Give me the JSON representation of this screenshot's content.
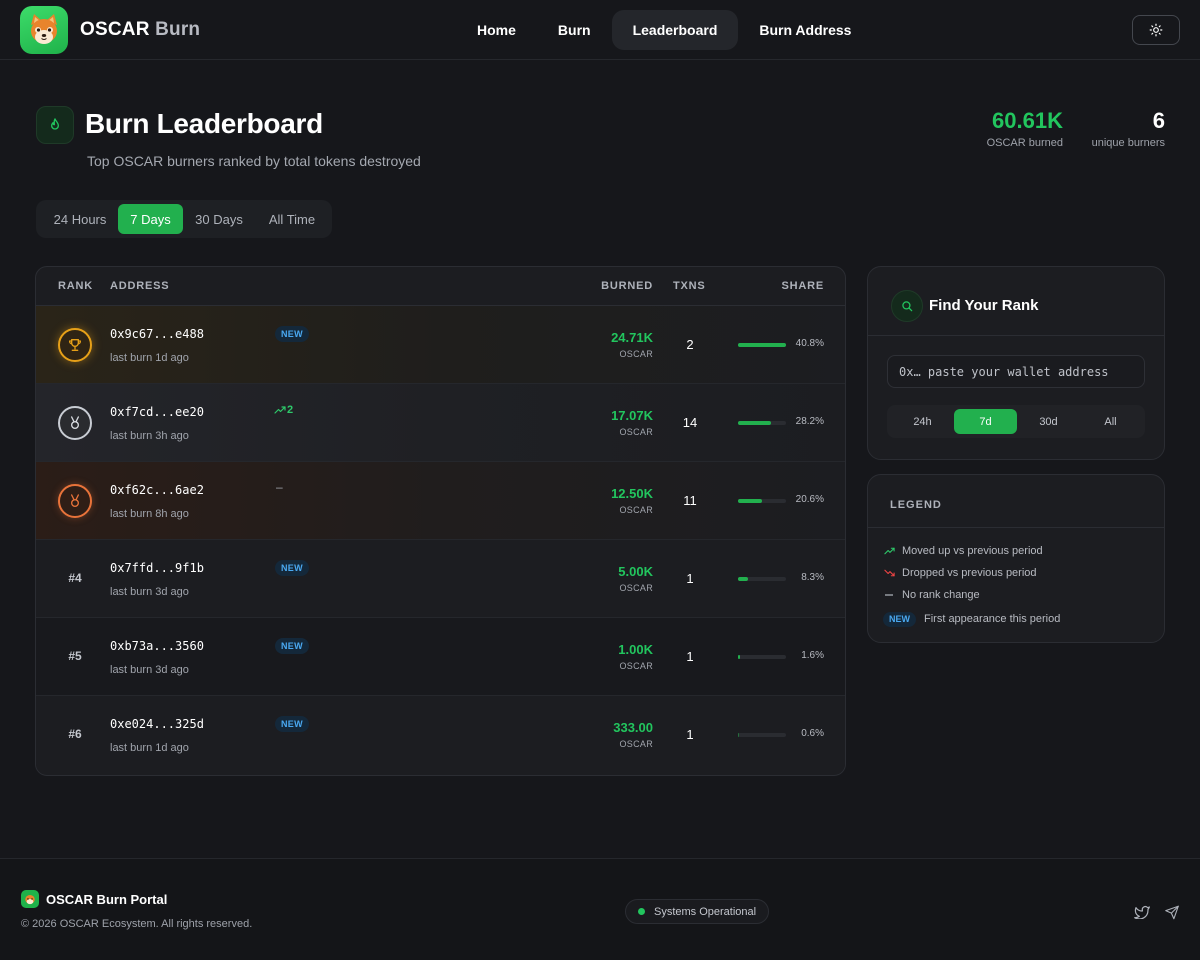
{
  "nav": {
    "brand_first": "OSCAR",
    "brand_second": "Burn",
    "links": [
      {
        "label": "Home",
        "active": false
      },
      {
        "label": "Burn",
        "active": false
      },
      {
        "label": "Leaderboard",
        "active": true
      },
      {
        "label": "Burn Address",
        "active": false
      }
    ],
    "theme_icon": "sun-icon"
  },
  "header": {
    "icon": "flame-icon",
    "title": "Burn Leaderboard",
    "subtitle": "Top OSCAR burners ranked by total tokens destroyed",
    "stats": {
      "burned_value": "60.61K",
      "burned_label": "OSCAR burned",
      "burners_value": "6",
      "burners_label": "unique burners"
    }
  },
  "period_tabs": {
    "items": [
      "24 Hours",
      "7 Days",
      "30 Days",
      "All Time"
    ],
    "active": "7 Days"
  },
  "leaderboard": {
    "columns": {
      "rank": "RANK",
      "address": "ADDRESS",
      "burned": "BURNED",
      "txns": "TXNS",
      "share": "SHARE"
    },
    "rows": [
      {
        "rank": "1",
        "medal": "gold",
        "medal_icon": "trophy-icon",
        "address": "0x9c67...e488",
        "last_burn": "last burn 1d ago",
        "change": "new",
        "badge": "NEW",
        "burned": "24.71K",
        "unit": "OSCAR",
        "txns": "2",
        "share_value": 40.8,
        "share": "40.8%"
      },
      {
        "rank": "2",
        "medal": "silver",
        "medal_icon": "medal-icon",
        "address": "0xf7cd...ee20",
        "last_burn": "last burn 3h ago",
        "change": "up",
        "change_text": "2",
        "burned": "17.07K",
        "unit": "OSCAR",
        "txns": "14",
        "share_value": 28.2,
        "share": "28.2%"
      },
      {
        "rank": "3",
        "medal": "bronze",
        "medal_icon": "medal-icon",
        "address": "0xf62c...6ae2",
        "last_burn": "last burn 8h ago",
        "change": "flat",
        "change_text": "–",
        "burned": "12.50K",
        "unit": "OSCAR",
        "txns": "11",
        "share_value": 20.6,
        "share": "20.6%"
      },
      {
        "rank": "#4",
        "address": "0x7ffd...9f1b",
        "last_burn": "last burn 3d ago",
        "change": "new",
        "badge": "NEW",
        "burned": "5.00K",
        "unit": "OSCAR",
        "txns": "1",
        "share_value": 8.3,
        "share": "8.3%"
      },
      {
        "rank": "#5",
        "address": "0xb73a...3560",
        "last_burn": "last burn 3d ago",
        "change": "new",
        "badge": "NEW",
        "burned": "1.00K",
        "unit": "OSCAR",
        "txns": "1",
        "share_value": 1.6,
        "share": "1.6%"
      },
      {
        "rank": "#6",
        "address": "0xe024...325d",
        "last_burn": "last burn 1d ago",
        "change": "new",
        "badge": "NEW",
        "burned": "333.00",
        "unit": "OSCAR",
        "txns": "1",
        "share_value": 0.6,
        "share": "0.6%"
      }
    ]
  },
  "find_rank": {
    "icon": "search-icon",
    "title": "Find Your Rank",
    "placeholder": "0x… paste your wallet address",
    "periods": [
      "24h",
      "7d",
      "30d",
      "All"
    ],
    "active_period": "7d"
  },
  "legend": {
    "title": "LEGEND",
    "items": [
      {
        "icon": "trend-up-icon",
        "text": "Moved up vs previous period"
      },
      {
        "icon": "trend-down-icon",
        "text": "Dropped vs previous period"
      },
      {
        "icon": "dash-icon",
        "text": "No rank change"
      },
      {
        "badge": "NEW",
        "text": "First appearance this period"
      }
    ]
  },
  "footer": {
    "brand": "OSCAR Burn Portal",
    "copyright": "© 2026 OSCAR Ecosystem. All rights reserved.",
    "status": "Systems Operational",
    "socials": [
      "twitter-icon",
      "telegram-icon"
    ]
  },
  "colors": {
    "accent_green": "#22c55e",
    "button_green": "#22b04e",
    "background": "#16171b",
    "gold": "#e6a018",
    "silver": "#c8ccd3",
    "bronze": "#e8733a",
    "new_badge": "#4aa8f0",
    "down_red": "#ef4444"
  }
}
